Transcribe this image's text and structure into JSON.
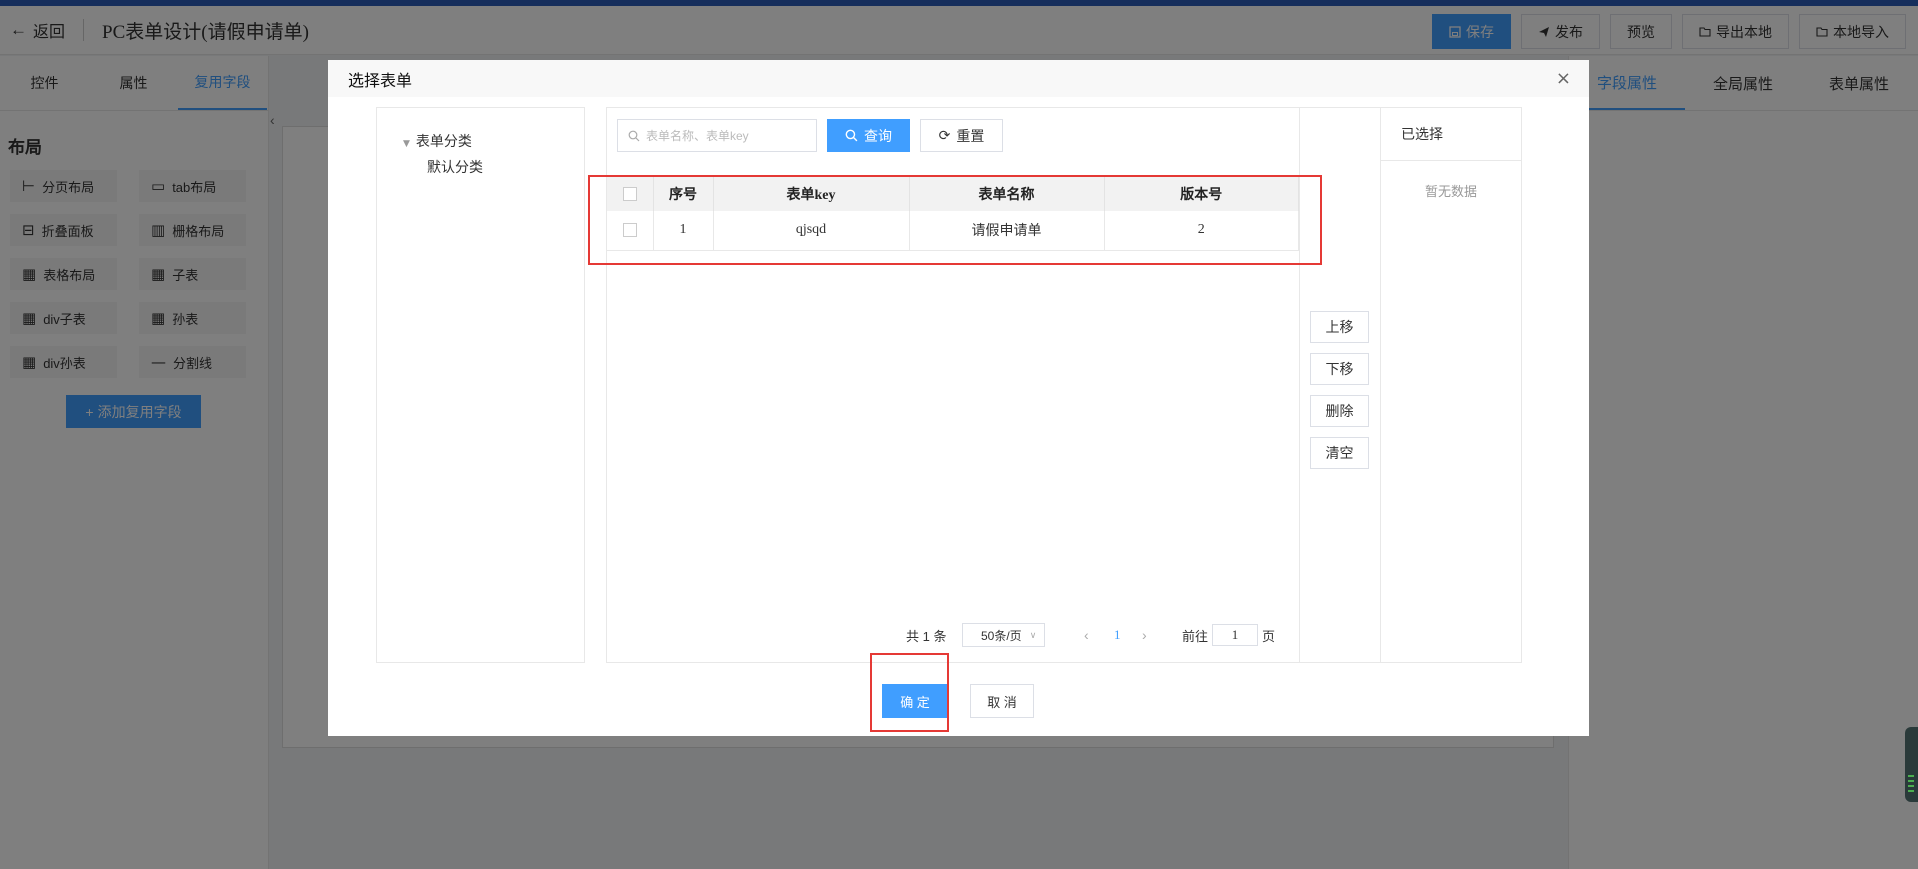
{
  "header": {
    "back_label": "返回",
    "title": "PC表单设计(请假申请单)",
    "buttons": {
      "save": "保存",
      "publish": "发布",
      "preview": "预览",
      "export": "导出本地",
      "import": "本地导入"
    }
  },
  "left_panel": {
    "tabs": [
      "控件",
      "属性",
      "复用字段"
    ],
    "active_tab": "复用字段",
    "section_title": "布局",
    "components": [
      {
        "label": "分页布局",
        "icon": "pagination-layout-icon"
      },
      {
        "label": "tab布局",
        "icon": "tab-layout-icon"
      },
      {
        "label": "折叠面板",
        "icon": "collapse-panel-icon"
      },
      {
        "label": "栅格布局",
        "icon": "grid-layout-icon"
      },
      {
        "label": "表格布局",
        "icon": "table-layout-icon"
      },
      {
        "label": "子表",
        "icon": "table-icon"
      },
      {
        "label": "div子表",
        "icon": "table-icon"
      },
      {
        "label": "孙表",
        "icon": "table-icon"
      },
      {
        "label": "div孙表",
        "icon": "table-icon"
      },
      {
        "label": "分割线",
        "icon": "divider-icon"
      }
    ],
    "add_button": "添加复用字段"
  },
  "right_panel": {
    "tabs": [
      "字段属性",
      "全局属性",
      "表单属性"
    ],
    "active_tab": "字段属性"
  },
  "dialog": {
    "title": "选择表单",
    "tree": {
      "root": "表单分类",
      "children": [
        "默认分类"
      ]
    },
    "search": {
      "placeholder": "表单名称、表单key",
      "query_label": "查询",
      "reset_label": "重置"
    },
    "table": {
      "columns": [
        "序号",
        "表单key",
        "表单名称",
        "版本号"
      ],
      "rows": [
        {
          "index": "1",
          "key": "qjsqd",
          "name": "请假申请单",
          "version": "2"
        }
      ]
    },
    "pagination": {
      "total": "共 1 条",
      "page_size": "50条/页",
      "current_page": "1",
      "goto_prefix": "前往",
      "goto_value": "1",
      "goto_suffix": "页"
    },
    "ops": [
      "上移",
      "下移",
      "删除",
      "清空"
    ],
    "selected": {
      "title": "已选择",
      "empty_text": "暂无数据"
    },
    "confirm_label": "确 定",
    "cancel_label": "取 消"
  },
  "colors": {
    "primary": "#409eff",
    "highlight": "#e53935",
    "top_strip": "#2d5db8"
  }
}
